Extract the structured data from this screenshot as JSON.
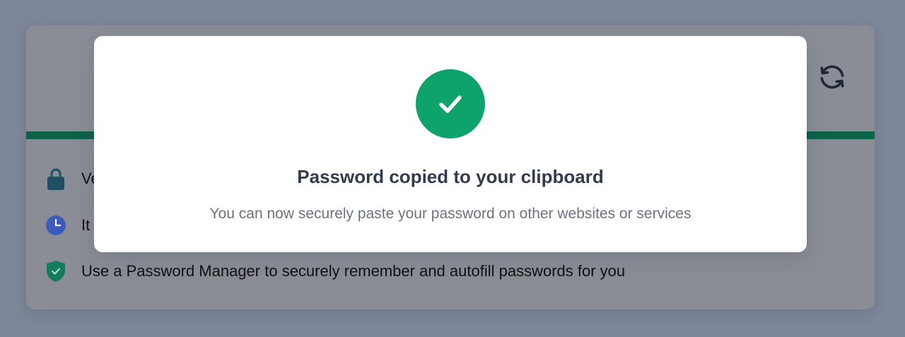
{
  "colors": {
    "page_overlay": "#7e8799",
    "card_dimmed": "#8a8d95",
    "strength_bar": "#0c6248",
    "success_green": "#0fa36c",
    "title_text": "#333c4a",
    "subtitle_text": "#6b7280",
    "lock_icon": "#1e4f63",
    "clock_icon": "#3b5bbd",
    "shield_icon": "#137a5a",
    "refresh_icon": "#1f2937"
  },
  "card": {
    "refresh_button": {
      "icon": "refresh-icon"
    },
    "tips": [
      {
        "icon": "lock-icon",
        "text": "Ve"
      },
      {
        "icon": "clock-icon",
        "text": "It"
      },
      {
        "icon": "shield-check-icon",
        "text": "Use a Password Manager to securely remember and autofill passwords for you"
      }
    ]
  },
  "modal": {
    "icon": "check-circle-icon",
    "title": "Password copied to your clipboard",
    "subtitle": "You can now securely paste your password on other websites or services"
  }
}
